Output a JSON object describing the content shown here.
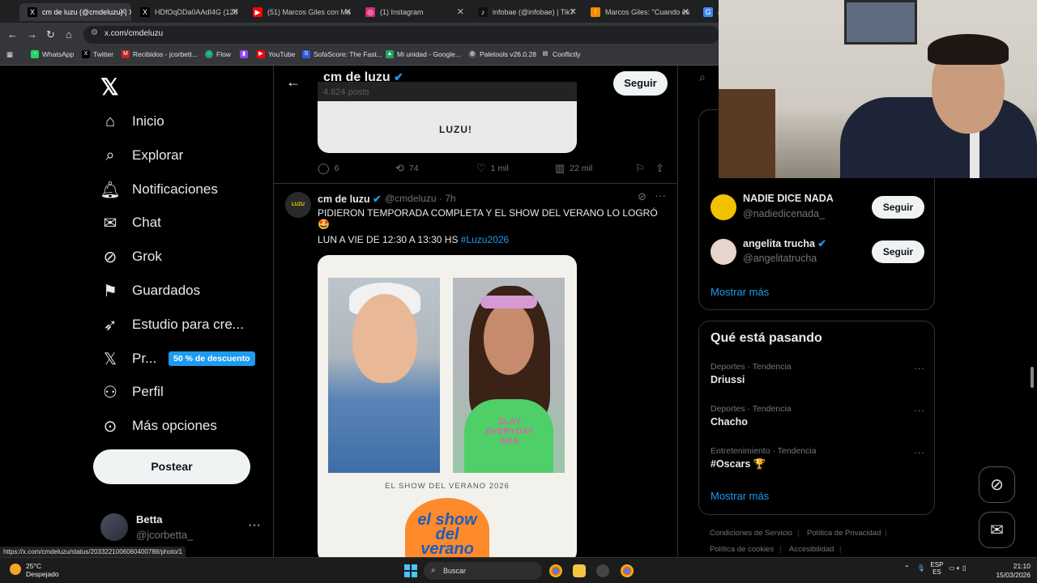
{
  "browser": {
    "tabs": [
      {
        "title": "cm de luzu (@cmdeluzu) | X",
        "icon": "X",
        "color": "#000000"
      },
      {
        "title": "HDfOqDDa0AAdI4G (120",
        "icon": "X",
        "color": "#000000"
      },
      {
        "title": "(51) Marcos Giles con Ma",
        "icon": "▶",
        "color": "#ff0000"
      },
      {
        "title": "(1) Instagram",
        "icon": "◎",
        "color": "#d62976"
      },
      {
        "title": "infobae (@infobae) | TikT",
        "icon": "♪",
        "color": "#111111"
      },
      {
        "title": "Marcos Giles: \"Cuando es",
        "icon": "!",
        "color": "#f28c00"
      },
      {
        "title": "al",
        "icon": "G",
        "color": "#4285f4"
      }
    ],
    "url": "x.com/cmdeluzu",
    "bookmarks": [
      "WhatsApp",
      "Twitter",
      "Recibidos - jcorbett...",
      "Flow",
      "",
      "YouTube",
      "SofaScore: The Fast...",
      "Mi unidad - Google...",
      "Paletools v26.0.28",
      "Conflictly"
    ],
    "status_url": "https://x.com/cmdeluzu/status/2033221006060400788/photo/1"
  },
  "nav": {
    "items": [
      "Inicio",
      "Explorar",
      "Notificaciones",
      "Chat",
      "Grok",
      "Guardados",
      "Estudio para cre...",
      "Pr...",
      "Perfil",
      "Más opciones"
    ],
    "promo": "50 % de descuento",
    "post_button": "Postear",
    "account_name": "Betta",
    "account_handle": "@jcorbetta_"
  },
  "profile": {
    "name": "cm de luzu",
    "posts": "4.824 posts",
    "follow_label": "Seguir"
  },
  "previous_tweet": {
    "image_text_big": "",
    "image_text_luzu": "LUZU!",
    "replies": "6",
    "retweets": "74",
    "likes": "1 mil",
    "views": "22 mil"
  },
  "tweet": {
    "name": "cm de luzu",
    "handle": "@cmdeluzu · 7h",
    "line1": "PIDIERON TEMPORADA COMPLETA Y EL SHOW DEL VERANO LO LOGRÓ",
    "emoji": "🤩",
    "line2": "LUN A VIE DE 12:30 A 13:30 HS ",
    "hashtag": "#Luzu2026",
    "card_shirt": "SLAY EVERYDAY ERA",
    "card_caption": "EL SHOW DEL VERANO 2026",
    "card_logo": "el show del verano"
  },
  "who_to_follow": [
    {
      "name": "NADIE DICE NADA",
      "handle": "@nadiedicenada_",
      "follow": "Seguir",
      "color": "#f2c200"
    },
    {
      "name": "angelita trucha",
      "handle": "@angelitatrucha",
      "follow": "Seguir",
      "color": "#e8d6cc"
    }
  ],
  "show_more": "Mostrar más",
  "trends": {
    "title": "Qué está pasando",
    "items": [
      {
        "category": "Deportes · Tendencia",
        "topic": "Driussi"
      },
      {
        "category": "Deportes · Tendencia",
        "topic": "Chacho"
      },
      {
        "category": "Entretenimiento · Tendencia",
        "topic": "#Oscars 🏆"
      }
    ],
    "show_more": "Mostrar más"
  },
  "footer": [
    "Condiciones de Servicio",
    "Política de Privacidad",
    "Política de cookies",
    "Accesibilidad"
  ],
  "taskbar": {
    "temp": "25°C",
    "weather": "Despejado",
    "search": "Buscar",
    "lang1": "ESP",
    "lang2": "ES",
    "time": "21:10",
    "date": "15/03/2026"
  },
  "colors": {
    "accent": "#1d9bf0",
    "background": "#000000"
  }
}
